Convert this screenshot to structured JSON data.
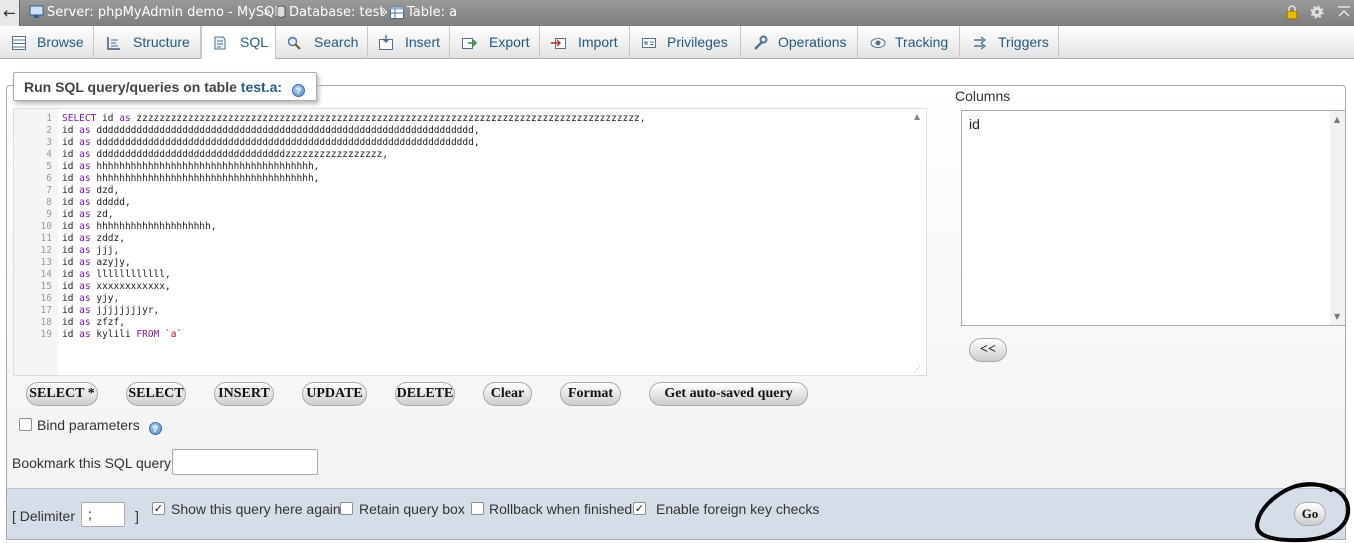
{
  "breadcrumb": {
    "back": "←",
    "server": "Server: phpMyAdmin demo - MySQL",
    "database": "Database: test",
    "table": "Table: a",
    "separator": "»"
  },
  "tabs": [
    {
      "label": "Browse",
      "icon": "browse-icon"
    },
    {
      "label": "Structure",
      "icon": "structure-icon"
    },
    {
      "label": "SQL",
      "icon": "sql-icon",
      "active": true
    },
    {
      "label": "Search",
      "icon": "search-icon"
    },
    {
      "label": "Insert",
      "icon": "insert-icon"
    },
    {
      "label": "Export",
      "icon": "export-icon"
    },
    {
      "label": "Import",
      "icon": "import-icon"
    },
    {
      "label": "Privileges",
      "icon": "privileges-icon"
    },
    {
      "label": "Operations",
      "icon": "operations-icon"
    },
    {
      "label": "Tracking",
      "icon": "tracking-icon"
    },
    {
      "label": "Triggers",
      "icon": "triggers-icon"
    }
  ],
  "legend": {
    "prefix": "Run SQL query/queries on table ",
    "table": "test.a:"
  },
  "editor": {
    "line_numbers": [
      "1",
      "2",
      "3",
      "4",
      "5",
      "6",
      "7",
      "8",
      "9",
      "10",
      "11",
      "12",
      "13",
      "14",
      "15",
      "16",
      "17",
      "18",
      "19"
    ],
    "lines": [
      "SELECT id as zzzzzzzzzzzzzzzzzzzzzzzzzzzzzzzzzzzzzzzzzzzzzzzzzzzzzzzzzzzzzzzzzzzzzzzzzzzzzzzzzzzzzzzz,",
      "id as dddddddddddddddddddddddddddddddddddddddddddddddddddddddddddddddddd,",
      "id as dddddddddddddddddddddddddddddddddddddddddddddddddddddddddddddddddd,",
      "id as dddddddddddddddddddddddddddddddddzzzzzzzzzzzzzzzzz,",
      "id as hhhhhhhhhhhhhhhhhhhhhhhhhhhhhhhhhhhhhh,",
      "id as hhhhhhhhhhhhhhhhhhhhhhhhhhhhhhhhhhhhhh,",
      "id as dzd,",
      "id as ddddd,",
      "id as zd,",
      "id as hhhhhhhhhhhhhhhhhhhh,",
      "id as zddz,",
      "id as jjj,",
      "id as azyjy,",
      "id as llllllllllll,",
      "id as xxxxxxxxxxxx,",
      "id as yjy,",
      "id as jjjjjjjjyr,",
      "id as zfzf,",
      "id as kylili FROM `a`"
    ]
  },
  "columns": {
    "label": "Columns",
    "options": [
      "id"
    ],
    "insert_button": "<<"
  },
  "buttons": {
    "select_star": "SELECT *",
    "select": "SELECT",
    "insert": "INSERT",
    "update": "UPDATE",
    "delete": "DELETE",
    "clear": "Clear",
    "format": "Format",
    "autosaved": "Get auto-saved query"
  },
  "bind_parameters": {
    "label": "Bind parameters",
    "checked": false
  },
  "bookmark": {
    "label": "Bookmark this SQL query:",
    "value": ""
  },
  "footer": {
    "delimiter_open": "[ Delimiter",
    "delimiter_value": ";",
    "delimiter_close": "]",
    "show_query": {
      "label": "Show this query here again",
      "checked": true
    },
    "retain_box": {
      "label": "Retain query box",
      "checked": false
    },
    "rollback": {
      "label": "Rollback when finished",
      "checked": false
    },
    "foreign_keys": {
      "label": "Enable foreign key checks",
      "checked": true
    },
    "go": "Go"
  }
}
